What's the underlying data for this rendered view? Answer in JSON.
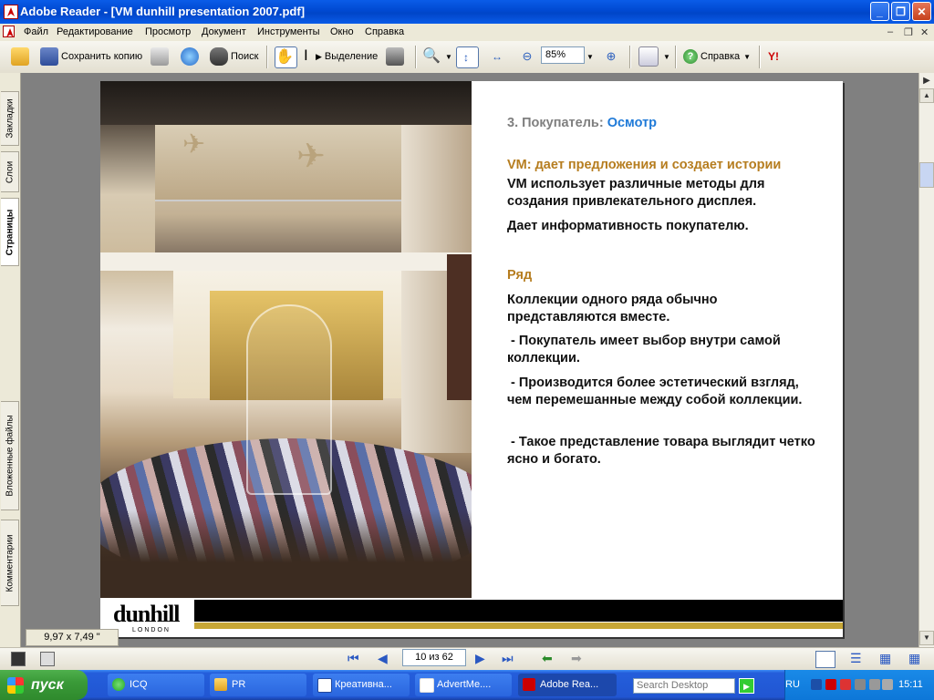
{
  "window": {
    "title": "Adobe Reader - [VM dunhill presentation 2007.pdf]"
  },
  "menu": [
    "Файл",
    "Редактирование",
    "Просмотр",
    "Документ",
    "Инструменты",
    "Окно",
    "Справка"
  ],
  "toolbar": {
    "save_copy": "Сохранить копию",
    "search": "Поиск",
    "select": "Выделение",
    "zoom": "85%",
    "help": "Справка"
  },
  "left_tabs": [
    "Закладки",
    "Слои",
    "Страницы",
    "Вложенные файлы",
    "Комментарии"
  ],
  "page": {
    "heading_prefix": "3. Покупатель:",
    "heading_highlight": "Осмотр",
    "vm_title": "VM: дает предложения и создает истории",
    "vm_p1": "VM использует различные методы для создания привлекательного дисплея.",
    "vm_p2": "Дает информативность покупателю.",
    "row_title": "Ряд",
    "row_p1": "Коллекции одного ряда обычно представляются вместе.",
    "row_b1": " - Покупатель имеет выбор внутри самой коллекции.",
    "row_b2": " - Производится более эстетический взгляд, чем перемешанные между собой коллекции.",
    "row_b3": " - Такое представление товара выглядит четко ясно и богато.",
    "logo": "dunhill",
    "logo_sub": "LONDON"
  },
  "status": {
    "page_size": "9,97 x 7,49 \"",
    "page_indicator": "10 из 62"
  },
  "taskbar": {
    "start": "пуск",
    "tasks": [
      "ICQ",
      "PR",
      "Креативна...",
      "AdvertMe....",
      "Adobe Rea..."
    ],
    "search_placeholder": "Search Desktop",
    "lang": "RU",
    "clock": "15:11"
  }
}
